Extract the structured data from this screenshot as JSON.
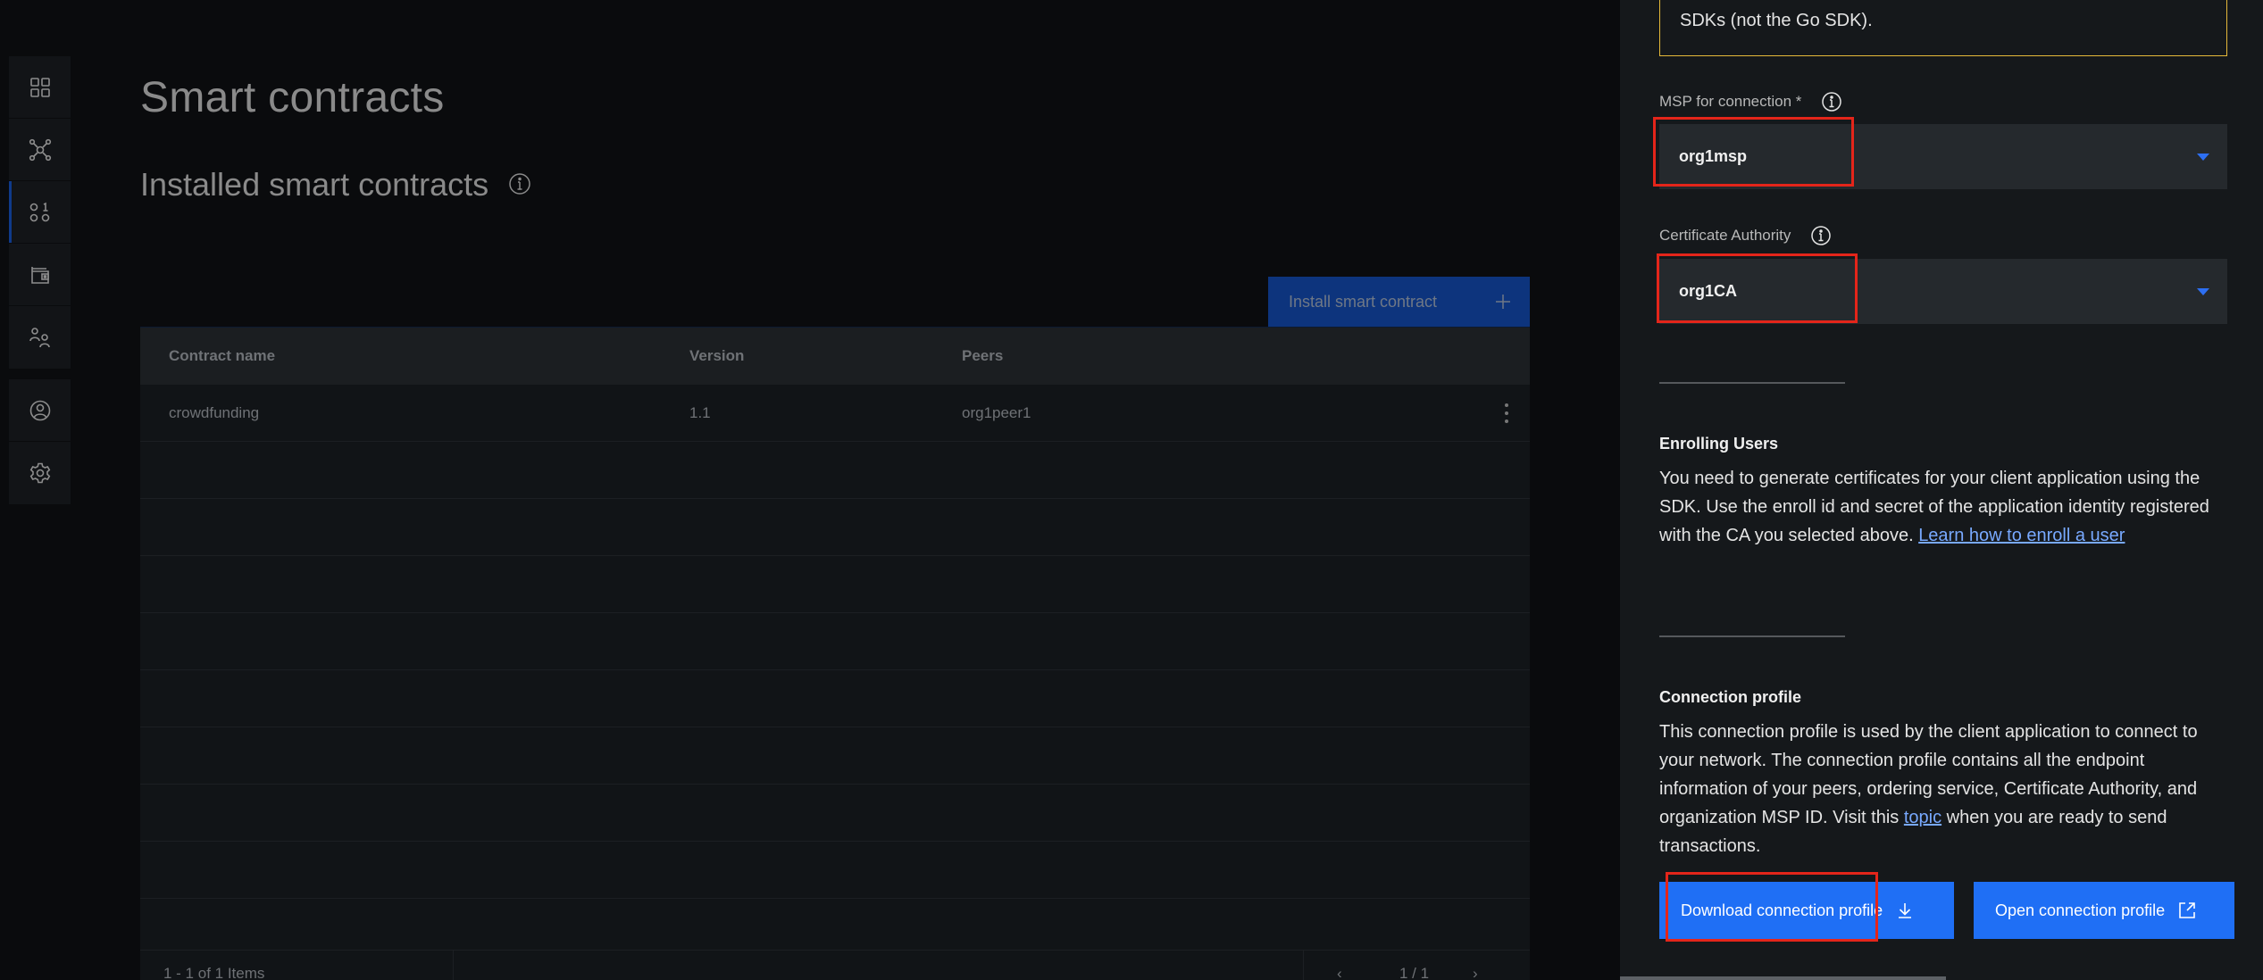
{
  "sidebar": {
    "items": [
      {
        "name": "dashboard",
        "icon": "grid-icon"
      },
      {
        "name": "nodes",
        "icon": "network-icon"
      },
      {
        "name": "smart-contracts",
        "icon": "binary-code-icon",
        "active": true
      },
      {
        "name": "wallet",
        "icon": "wallet-icon"
      },
      {
        "name": "organizations",
        "icon": "users-icon"
      }
    ],
    "bottom_items": [
      {
        "name": "user-profile",
        "icon": "user-avatar-icon"
      },
      {
        "name": "settings",
        "icon": "gear-icon"
      }
    ]
  },
  "main": {
    "title": "Smart contracts",
    "section_title": "Installed smart contracts",
    "install_button": "Install smart contract",
    "table": {
      "columns": [
        "Contract name",
        "Version",
        "Peers"
      ],
      "rows": [
        {
          "name": "crowdfunding",
          "version": "1.1",
          "peers": "org1peer1"
        }
      ]
    },
    "pagination": {
      "count": "1 - 1 of 1 Items",
      "page": "1 / 1",
      "prev": "‹",
      "next": "›"
    }
  },
  "panel": {
    "notice_text": "SDKs (not the Go SDK).",
    "msp_label": "MSP for connection *",
    "msp_value": "org1msp",
    "ca_label": "Certificate Authority",
    "ca_value": "org1CA",
    "enrolling": {
      "heading": "Enrolling Users",
      "text": "You need to generate certificates for your client application using the SDK. Use the enroll id and secret of the application identity registered with the CA you selected above.",
      "link": "Learn how to enroll a user"
    },
    "connection": {
      "heading": "Connection profile",
      "text_before": "This connection profile is used by the client application to connect to your network. The connection profile contains all the endpoint information of your peers, ordering service, Certificate Authority, and organization MSP ID. Visit this",
      "link": "topic",
      "text_after": "when you are ready to send transactions."
    },
    "download_button": "Download connection profile",
    "open_button": "Open connection profile"
  },
  "colors": {
    "accent_blue": "#1f6ff5",
    "highlight_red": "#e4251a",
    "notice_yellow": "#e6b93a",
    "link_blue": "#78a9ff"
  }
}
